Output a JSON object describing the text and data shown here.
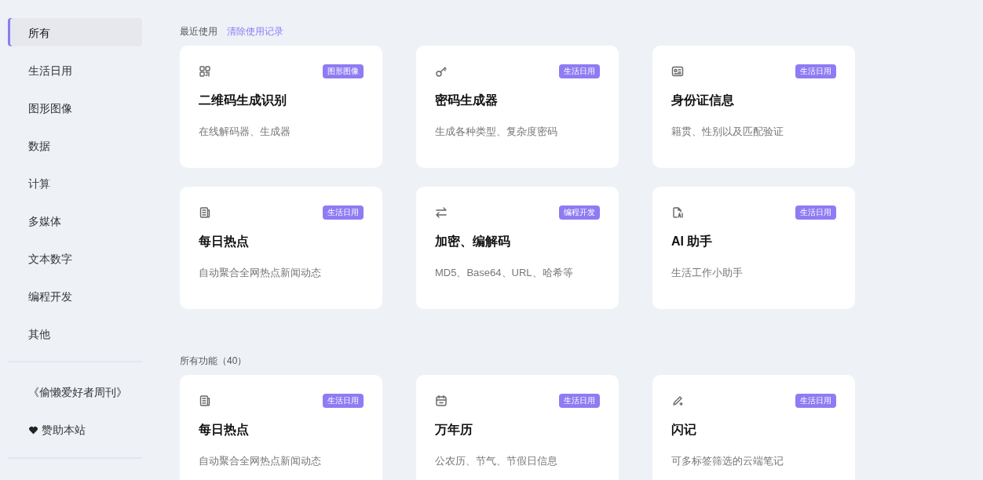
{
  "sidebar": {
    "items": [
      {
        "label": "所有",
        "selected": true
      },
      {
        "label": "生活日用",
        "selected": false
      },
      {
        "label": "图形图像",
        "selected": false
      },
      {
        "label": "数据",
        "selected": false
      },
      {
        "label": "计算",
        "selected": false
      },
      {
        "label": "多媒体",
        "selected": false
      },
      {
        "label": "文本数字",
        "selected": false
      },
      {
        "label": "编程开发",
        "selected": false
      },
      {
        "label": "其他",
        "selected": false
      }
    ],
    "links": [
      {
        "label": "《偷懒爱好者周刊》"
      },
      {
        "label": "赞助本站"
      }
    ]
  },
  "recent": {
    "title": "最近使用",
    "clear_link": "清除使用记录",
    "cards": [
      {
        "title": "二维码生成识别",
        "desc": "在线解码器、生成器",
        "tag": "图形图像"
      },
      {
        "title": "密码生成器",
        "desc": "生成各种类型、复杂度密码",
        "tag": "生活日用"
      },
      {
        "title": "身份证信息",
        "desc": "籍贯、性别以及匹配验证",
        "tag": "生活日用"
      },
      {
        "title": "每日热点",
        "desc": "自动聚合全网热点新闻动态",
        "tag": "生活日用"
      },
      {
        "title": "加密、编解码",
        "desc": "MD5、Base64、URL、哈希等",
        "tag": "编程开发"
      },
      {
        "title": "AI 助手",
        "desc": "生活工作小助手",
        "tag": "生活日用"
      }
    ]
  },
  "all": {
    "title": "所有功能（40）",
    "cards": [
      {
        "title": "每日热点",
        "desc": "自动聚合全网热点新闻动态",
        "tag": "生活日用"
      },
      {
        "title": "万年历",
        "desc": "公农历、节气、节假日信息",
        "tag": "生活日用"
      },
      {
        "title": "闪记",
        "desc": "可多标签筛选的云端笔记",
        "tag": "生活日用"
      }
    ]
  }
}
